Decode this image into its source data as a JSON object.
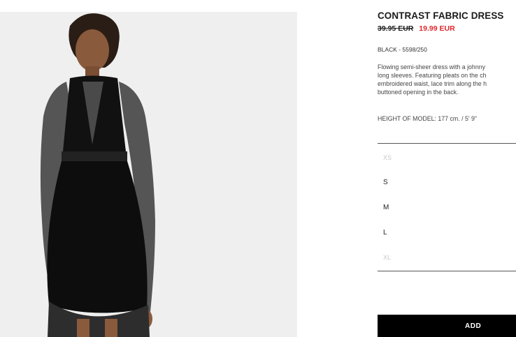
{
  "product": {
    "title": "CONTRAST FABRIC DRESS",
    "old_price": "39.95 EUR",
    "new_price": "19.99 EUR",
    "color_ref": "BLACK - 5598/250",
    "description_lines": [
      "Flowing semi-sheer dress with a johnny",
      "long sleeves. Featuring pleats on the ch",
      "embroidered waist, lace trim along the h",
      "buttoned opening in the back."
    ],
    "model_height": "HEIGHT OF MODEL: 177 cm. / 5' 9\""
  },
  "sizes": [
    {
      "label": "XS",
      "available": false
    },
    {
      "label": "S",
      "available": true
    },
    {
      "label": "M",
      "available": true
    },
    {
      "label": "L",
      "available": true
    },
    {
      "label": "XL",
      "available": false
    }
  ],
  "actions": {
    "add_label": "ADD"
  },
  "colors": {
    "sale_red": "#e0262b",
    "button_black": "#000000",
    "image_bg": "#efefef"
  }
}
